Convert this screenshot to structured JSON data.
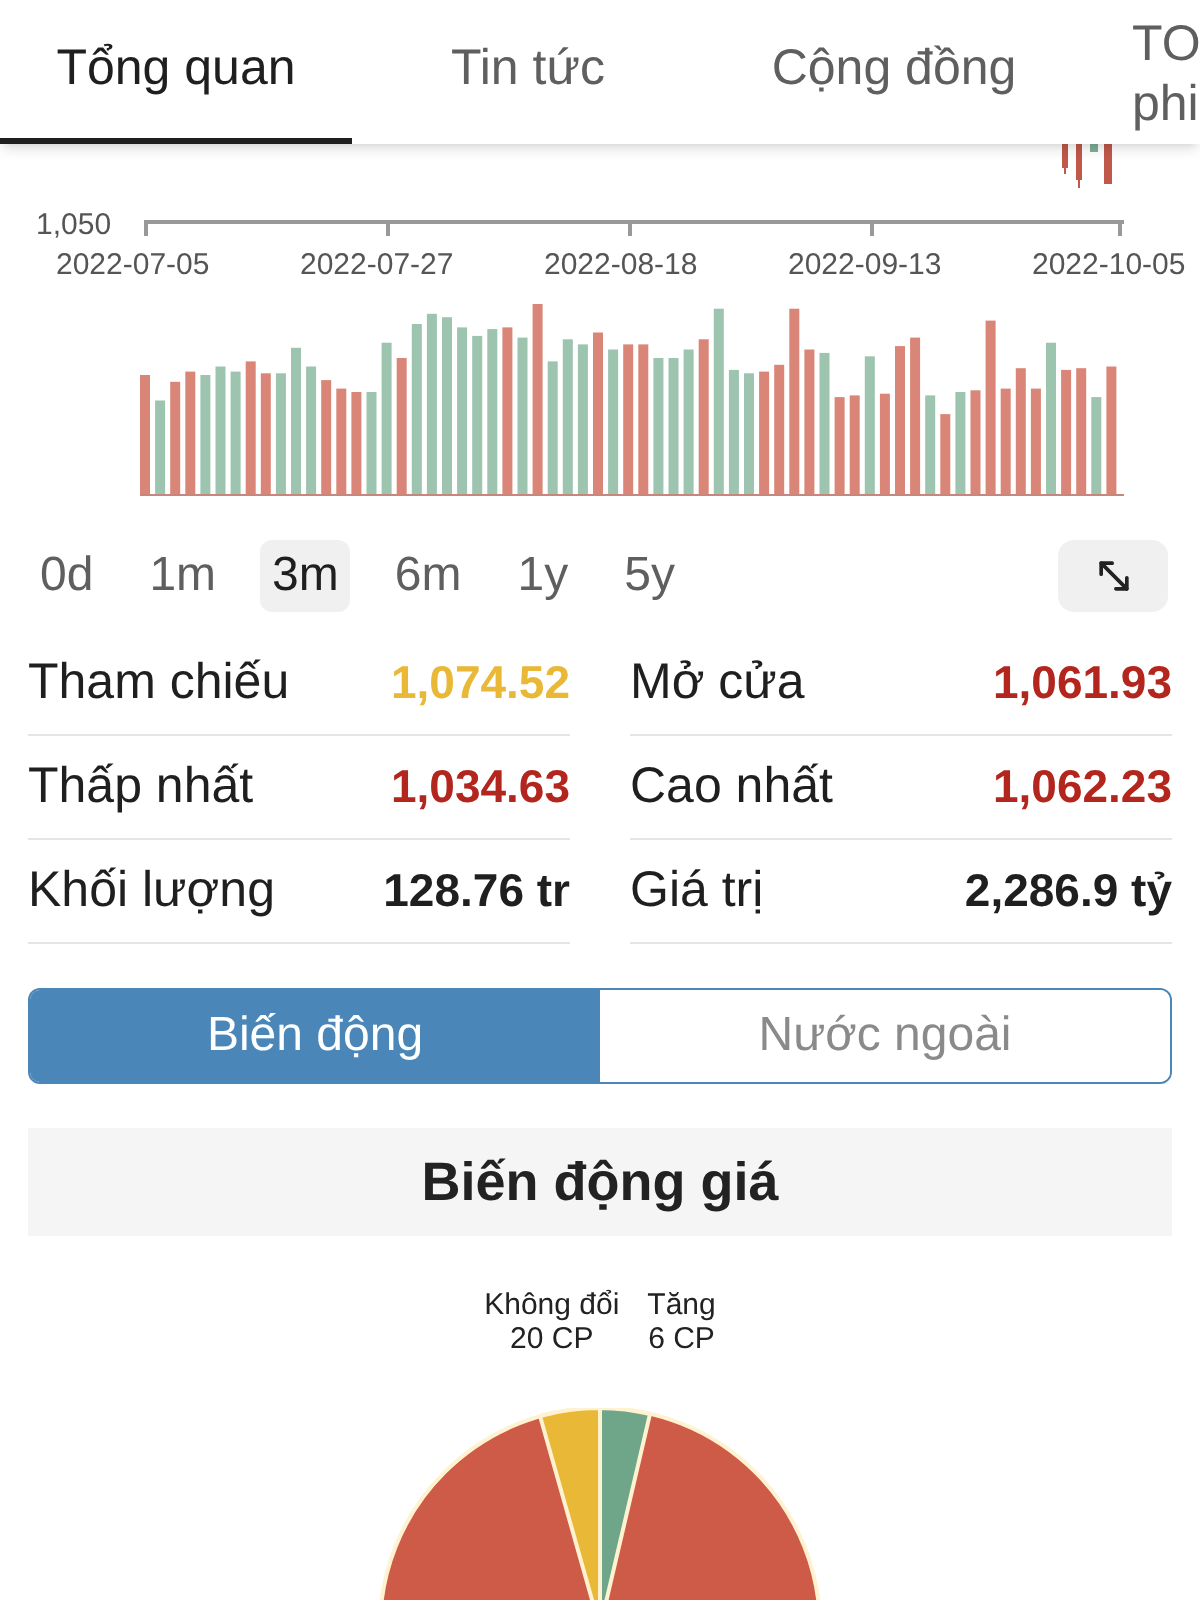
{
  "tabs": [
    {
      "label": "Tổng quan",
      "selected": true
    },
    {
      "label": "Tin tức",
      "selected": false
    },
    {
      "label": "Cộng đồng",
      "selected": false
    },
    {
      "label": "TO phi",
      "selected": false
    }
  ],
  "price_chart": {
    "y_label": "1,050",
    "dates": [
      "2022-07-05",
      "2022-07-27",
      "2022-08-18",
      "2022-09-13",
      "2022-10-05"
    ]
  },
  "periods": [
    {
      "label": "0d",
      "selected": false
    },
    {
      "label": "1m",
      "selected": false
    },
    {
      "label": "3m",
      "selected": true
    },
    {
      "label": "6m",
      "selected": false
    },
    {
      "label": "1y",
      "selected": false
    },
    {
      "label": "5y",
      "selected": false
    }
  ],
  "stats": [
    {
      "label": "Tham chiếu",
      "value": "1,074.52",
      "color": "#e8b836"
    },
    {
      "label": "Mở cửa",
      "value": "1,061.93",
      "color": "#b3261e"
    },
    {
      "label": "Thấp nhất",
      "value": "1,034.63",
      "color": "#b3261e"
    },
    {
      "label": "Cao nhất",
      "value": "1,062.23",
      "color": "#b3261e"
    },
    {
      "label": "Khối lượng",
      "value": "128.76 tr",
      "color": "#1f1f1f"
    },
    {
      "label": "Giá trị",
      "value": "2,286.9 tỷ",
      "color": "#1f1f1f"
    }
  ],
  "toggle": [
    {
      "label": "Biến động",
      "selected": true
    },
    {
      "label": "Nước ngoài",
      "selected": false
    }
  ],
  "section_title": "Biến động giá",
  "pie_labels": [
    {
      "name": "Không đổi",
      "count": "20 CP"
    },
    {
      "name": "Tăng",
      "count": "6 CP"
    }
  ]
}
